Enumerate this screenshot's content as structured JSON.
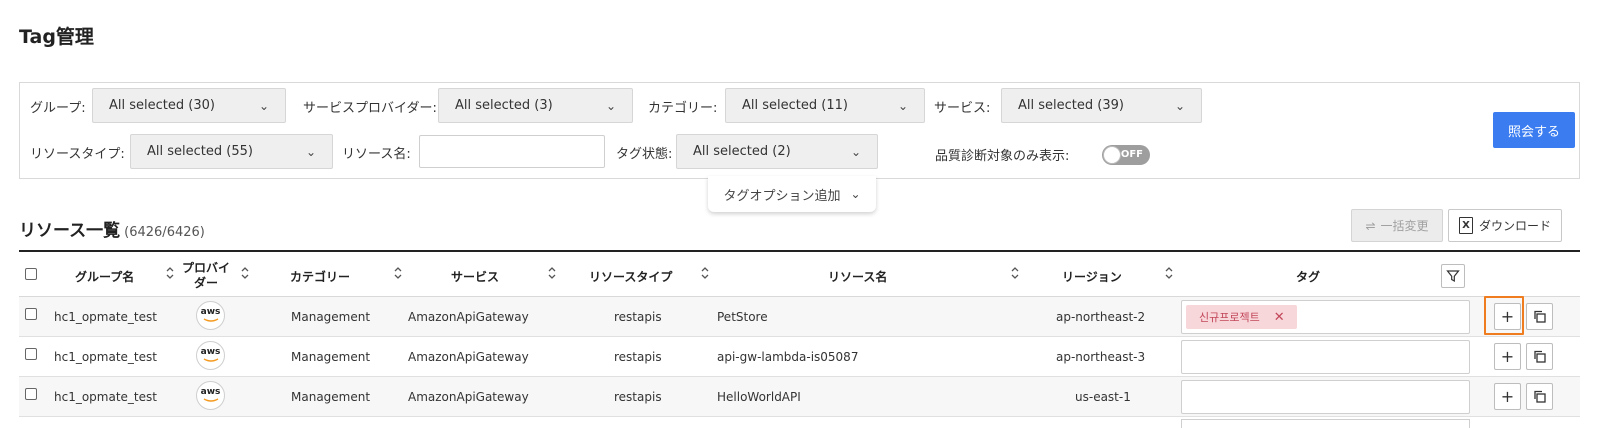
{
  "page": {
    "title": "Tag管理"
  },
  "filters": {
    "group_label": "グループ:",
    "group_value": "All selected (30)",
    "provider_label": "サービスプロバイダー:",
    "provider_value": "All selected (3)",
    "category_label": "カテゴリー:",
    "category_value": "All selected (11)",
    "service_label": "サービス:",
    "service_value": "All selected (39)",
    "resource_type_label": "リソースタイプ:",
    "resource_type_value": "All selected (55)",
    "resource_name_label": "リソース名:",
    "resource_name_value": "",
    "tag_state_label": "タグ状態:",
    "tag_state_value": "All selected (2)",
    "quality_label": "品質診断対象のみ表示:",
    "quality_toggle": "OFF",
    "query_button": "照会する",
    "tag_option_add": "タグオプション追加"
  },
  "list": {
    "title": "リソース一覧",
    "count": "(6426/6426)",
    "bulk_change": "一括変更",
    "download": "ダウンロード"
  },
  "table": {
    "headers": {
      "group": "グループ名",
      "provider": "プロバイダー",
      "category": "カテゴリー",
      "service": "サービス",
      "resource_type": "リソースタイプ",
      "resource_name": "リソース名",
      "region": "リージョン",
      "tag": "タグ"
    },
    "rows": [
      {
        "group": "hc1_opmate_test",
        "provider": "aws",
        "category": "Management",
        "service": "AmazonApiGateway",
        "resource_type": "restapis",
        "resource_name": "PetStore",
        "region": "ap-northeast-2",
        "tag": "신규프로젝트"
      },
      {
        "group": "hc1_opmate_test",
        "provider": "aws",
        "category": "Management",
        "service": "AmazonApiGateway",
        "resource_type": "restapis",
        "resource_name": "api-gw-lambda-is05087",
        "region": "ap-northeast-3",
        "tag": ""
      },
      {
        "group": "hc1_opmate_test",
        "provider": "aws",
        "category": "Management",
        "service": "AmazonApiGateway",
        "resource_type": "restapis",
        "resource_name": "HelloWorldAPI",
        "region": "us-east-1",
        "tag": ""
      }
    ]
  },
  "colors": {
    "primary": "#3b7df1",
    "highlight": "#f07c20",
    "tag_chip_bg": "#f8d7da",
    "tag_chip_text": "#c2475a",
    "aws_orange": "#f49a1f"
  }
}
